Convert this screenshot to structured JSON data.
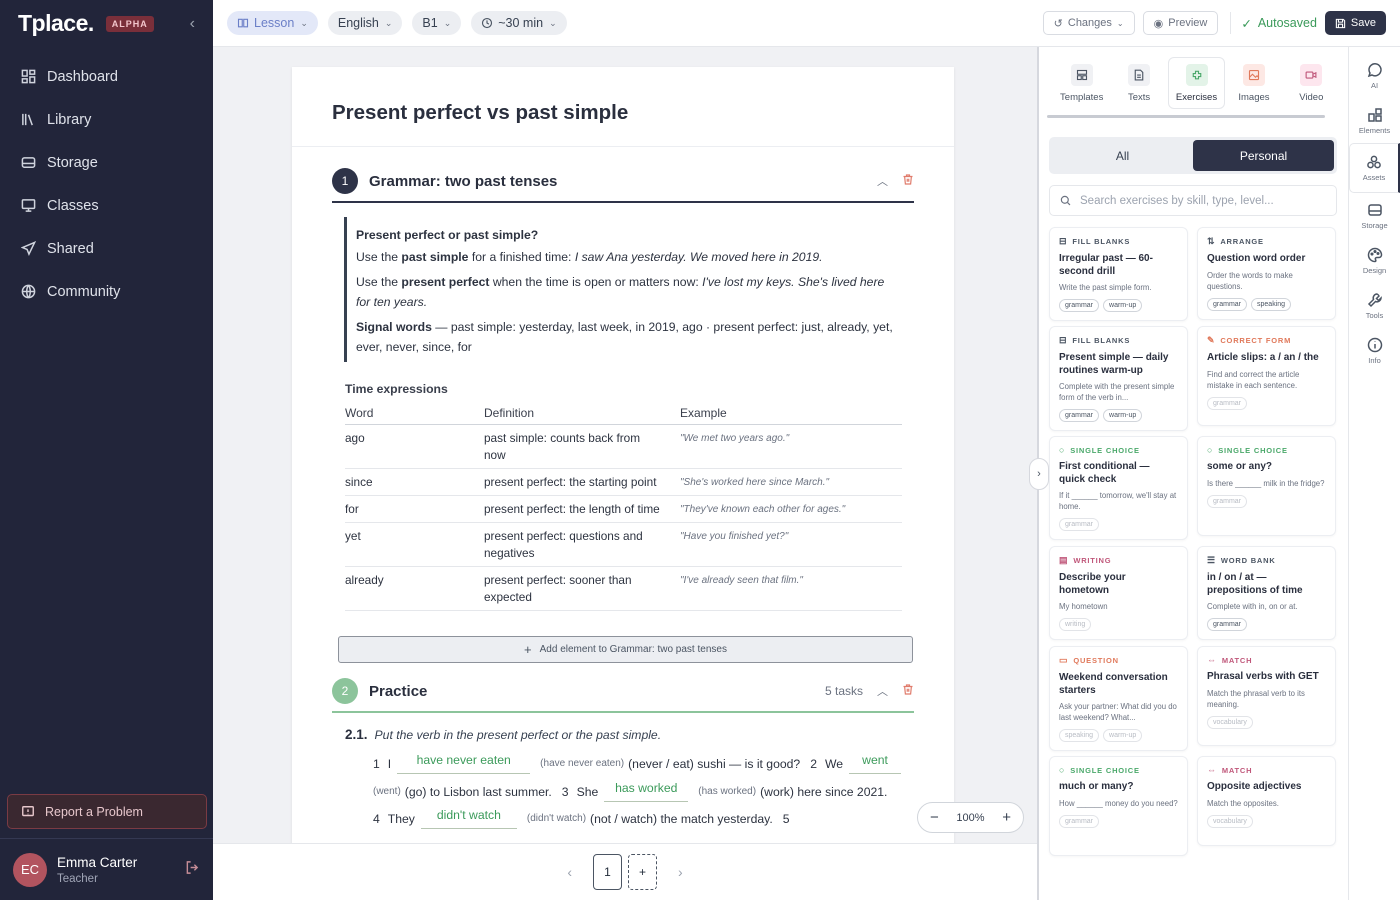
{
  "app": {
    "logo": "Tplace.",
    "badge": "ALPHA",
    "collapse": "‹"
  },
  "nav": [
    {
      "label": "Dashboard",
      "icon": "grid-icon"
    },
    {
      "label": "Library",
      "icon": "books-icon"
    },
    {
      "label": "Storage",
      "icon": "drive-icon"
    },
    {
      "label": "Classes",
      "icon": "monitor-icon"
    },
    {
      "label": "Shared",
      "icon": "send-icon"
    },
    {
      "label": "Community",
      "icon": "globe-icon"
    }
  ],
  "report": "Report a Problem",
  "user": {
    "initials": "EC",
    "name": "Emma Carter",
    "role": "Teacher"
  },
  "topbar": {
    "type": "Lesson",
    "language": "English",
    "level": "B1",
    "duration": "~30 min",
    "changes": "Changes",
    "preview": "Preview",
    "autosaved": "Autosaved",
    "save": "Save"
  },
  "doc": {
    "title": "Present perfect vs past simple"
  },
  "section1": {
    "num": "1",
    "title": "Grammar: two past tenses",
    "callout": {
      "q": "Present perfect or past simple?",
      "l1a": "Use the ",
      "l1b": "past simple",
      "l1c": " for a finished time: ",
      "l1d": "I saw Ana yesterday. We moved here in 2019.",
      "l2a": "Use the ",
      "l2b": "present perfect",
      "l2c": " when the time is open or matters now: ",
      "l2d": "I've lost my keys. She's lived here for ten years.",
      "l3a": "Signal words",
      "l3b": " — past simple: yesterday, last week, in 2019, ago · present perfect: just, already, yet, ever, never, since, for"
    },
    "table_title": "Time expressions",
    "headers": [
      "Word",
      "Definition",
      "Example"
    ],
    "rows": [
      {
        "w": "ago",
        "d": "past simple: counts back from now",
        "e": "\"We met two years ago.\""
      },
      {
        "w": "since",
        "d": "present perfect: the starting point",
        "e": "\"She's worked here since March.\""
      },
      {
        "w": "for",
        "d": "present perfect: the length of time",
        "e": "\"They've known each other for ages.\""
      },
      {
        "w": "yet",
        "d": "present perfect: questions and negatives",
        "e": "\"Have you finished yet?\""
      },
      {
        "w": "already",
        "d": "present perfect: sooner than expected",
        "e": "\"I've already seen that film.\""
      }
    ],
    "add": "Add element to Grammar: two past tenses"
  },
  "section2": {
    "num": "2",
    "title": "Practice",
    "tasks": "5 tasks",
    "task_num": "2.1.",
    "instruction": "Put the verb in the present perfect or the past simple.",
    "l1": {
      "n1": "1",
      "pre": "I",
      "a1": "have never eaten",
      "h1": "(have never eaten)",
      "t1": "(never / eat) sushi — is it good?",
      "n2": "2",
      "t2": "We",
      "a2": "went"
    },
    "l2": {
      "h1": "(went)",
      "t1": "(go) to Lisbon last summer.",
      "n3": "3",
      "t3": "She",
      "a3": "has worked",
      "h2": "(has worked)",
      "t4": "(work) here since 2021."
    },
    "l3": {
      "n4": "4",
      "t1": "They",
      "a4": "didn't watch",
      "h1": "(didn't watch)",
      "t2": "(not / watch) the match yesterday.",
      "n5": "5"
    }
  },
  "zoom": {
    "level": "100%"
  },
  "pager": {
    "page": "1"
  },
  "panel": {
    "tabs": [
      {
        "label": "Templates",
        "icon": "templates-icon"
      },
      {
        "label": "Texts",
        "icon": "text-doc-icon"
      },
      {
        "label": "Exercises",
        "icon": "puzzle-icon"
      },
      {
        "label": "Images",
        "icon": "image-icon"
      },
      {
        "label": "Video",
        "icon": "video-icon"
      }
    ],
    "seg": {
      "all": "All",
      "personal": "Personal"
    },
    "search_placeholder": "Search exercises by skill, type, level...",
    "cards": [
      {
        "type": "FILL BLANKS",
        "title": "Irregular past — 60-second drill",
        "desc": "Write the past simple form.",
        "tags": [
          "grammar",
          "warm-up"
        ],
        "color": "#4b5563"
      },
      {
        "type": "ARRANGE",
        "title": "Question word order",
        "desc": "Order the words to make questions.",
        "tags": [
          "grammar",
          "speaking"
        ],
        "color": "#4b5563"
      },
      {
        "type": "FILL BLANKS",
        "title": "Present simple — daily routines warm-up",
        "desc": "Complete with the present simple form of the verb in...",
        "tags": [
          "grammar",
          "warm-up"
        ],
        "color": "#4b5563"
      },
      {
        "type": "CORRECT FORM",
        "title": "Article slips: a / an / the",
        "desc": "Find and correct the article mistake in each sentence.",
        "tags": [
          "grammar"
        ],
        "color": "#e0795b"
      },
      {
        "type": "SINGLE CHOICE",
        "title": "First conditional — quick check",
        "desc": "If it ______ tomorrow, we'll stay at home.",
        "tags": [
          "grammar"
        ],
        "color": "#4aa86a"
      },
      {
        "type": "SINGLE CHOICE",
        "title": "some or any?",
        "desc": "Is there ______ milk in the fridge?",
        "tags": [
          "grammar"
        ],
        "color": "#4aa86a"
      },
      {
        "type": "WRITING",
        "title": "Describe your hometown",
        "desc": "My hometown",
        "tags": [
          "writing"
        ],
        "color": "#c0577a"
      },
      {
        "type": "WORD BANK",
        "title": "in / on / at — prepositions of time",
        "desc": "Complete with in, on or at.",
        "tags": [
          "grammar"
        ],
        "color": "#4b5563"
      },
      {
        "type": "QUESTION",
        "title": "Weekend conversation starters",
        "desc": "Ask your partner: What did you do last weekend? What...",
        "tags": [
          "speaking",
          "warm-up"
        ],
        "color": "#e0795b"
      },
      {
        "type": "MATCH",
        "title": "Phrasal verbs with GET",
        "desc": "Match the phrasal verb to its meaning.",
        "tags": [
          "vocabulary"
        ],
        "color": "#c0577a"
      },
      {
        "type": "SINGLE CHOICE",
        "title": "much or many?",
        "desc": "How ______ money do you need?",
        "tags": [
          "grammar"
        ],
        "color": "#4aa86a"
      },
      {
        "type": "MATCH",
        "title": "Opposite adjectives",
        "desc": "Match the opposites.",
        "tags": [
          "vocabulary"
        ],
        "color": "#c0577a"
      }
    ]
  },
  "rail": [
    {
      "label": "AI",
      "icon": "chat-icon"
    },
    {
      "label": "Elements",
      "icon": "elements-icon"
    },
    {
      "label": "Assets",
      "icon": "assets-icon"
    },
    {
      "label": "Storage",
      "icon": "storage-icon"
    },
    {
      "label": "Design",
      "icon": "palette-icon"
    },
    {
      "label": "Tools",
      "icon": "wrench-icon"
    },
    {
      "label": "Info",
      "icon": "info-icon"
    }
  ]
}
